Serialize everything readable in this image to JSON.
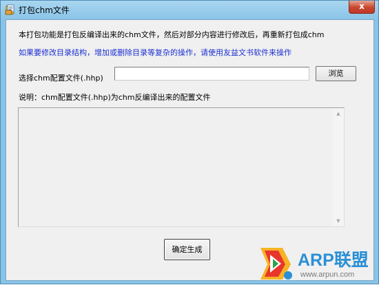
{
  "window": {
    "title": "打包chm文件",
    "close_glyph": "x"
  },
  "content": {
    "intro_text": "本打包功能是打包反编译出来的chm文件，然后对部分内容进行修改后，再重新打包成chm",
    "note_text": "如果要修改目录结构，增加或删除目录等复杂的操作，请使用友益文书软件来操作",
    "file_label": "选择chm配置文件(.hhp)",
    "file_input_value": "",
    "browse_label": "浏览",
    "description_text": "说明：chm配置文件(.hhp)为chm反编译出来的配置文件",
    "generate_label": "确定生成"
  },
  "watermark": {
    "name": "ARP联盟",
    "url": "www.arpun.com"
  },
  "colors": {
    "note_text": "#1c2fd1",
    "titlebar": "#8cc5e8",
    "close_button": "#c9462c",
    "watermark_blue": "#2a8fd6"
  },
  "icons": {
    "title": "document-package-icon",
    "close": "close-icon",
    "scroll_up": "scroll-up-arrow-icon",
    "scroll_down": "scroll-down-arrow-icon",
    "watermark": "arp-logo-icon"
  }
}
